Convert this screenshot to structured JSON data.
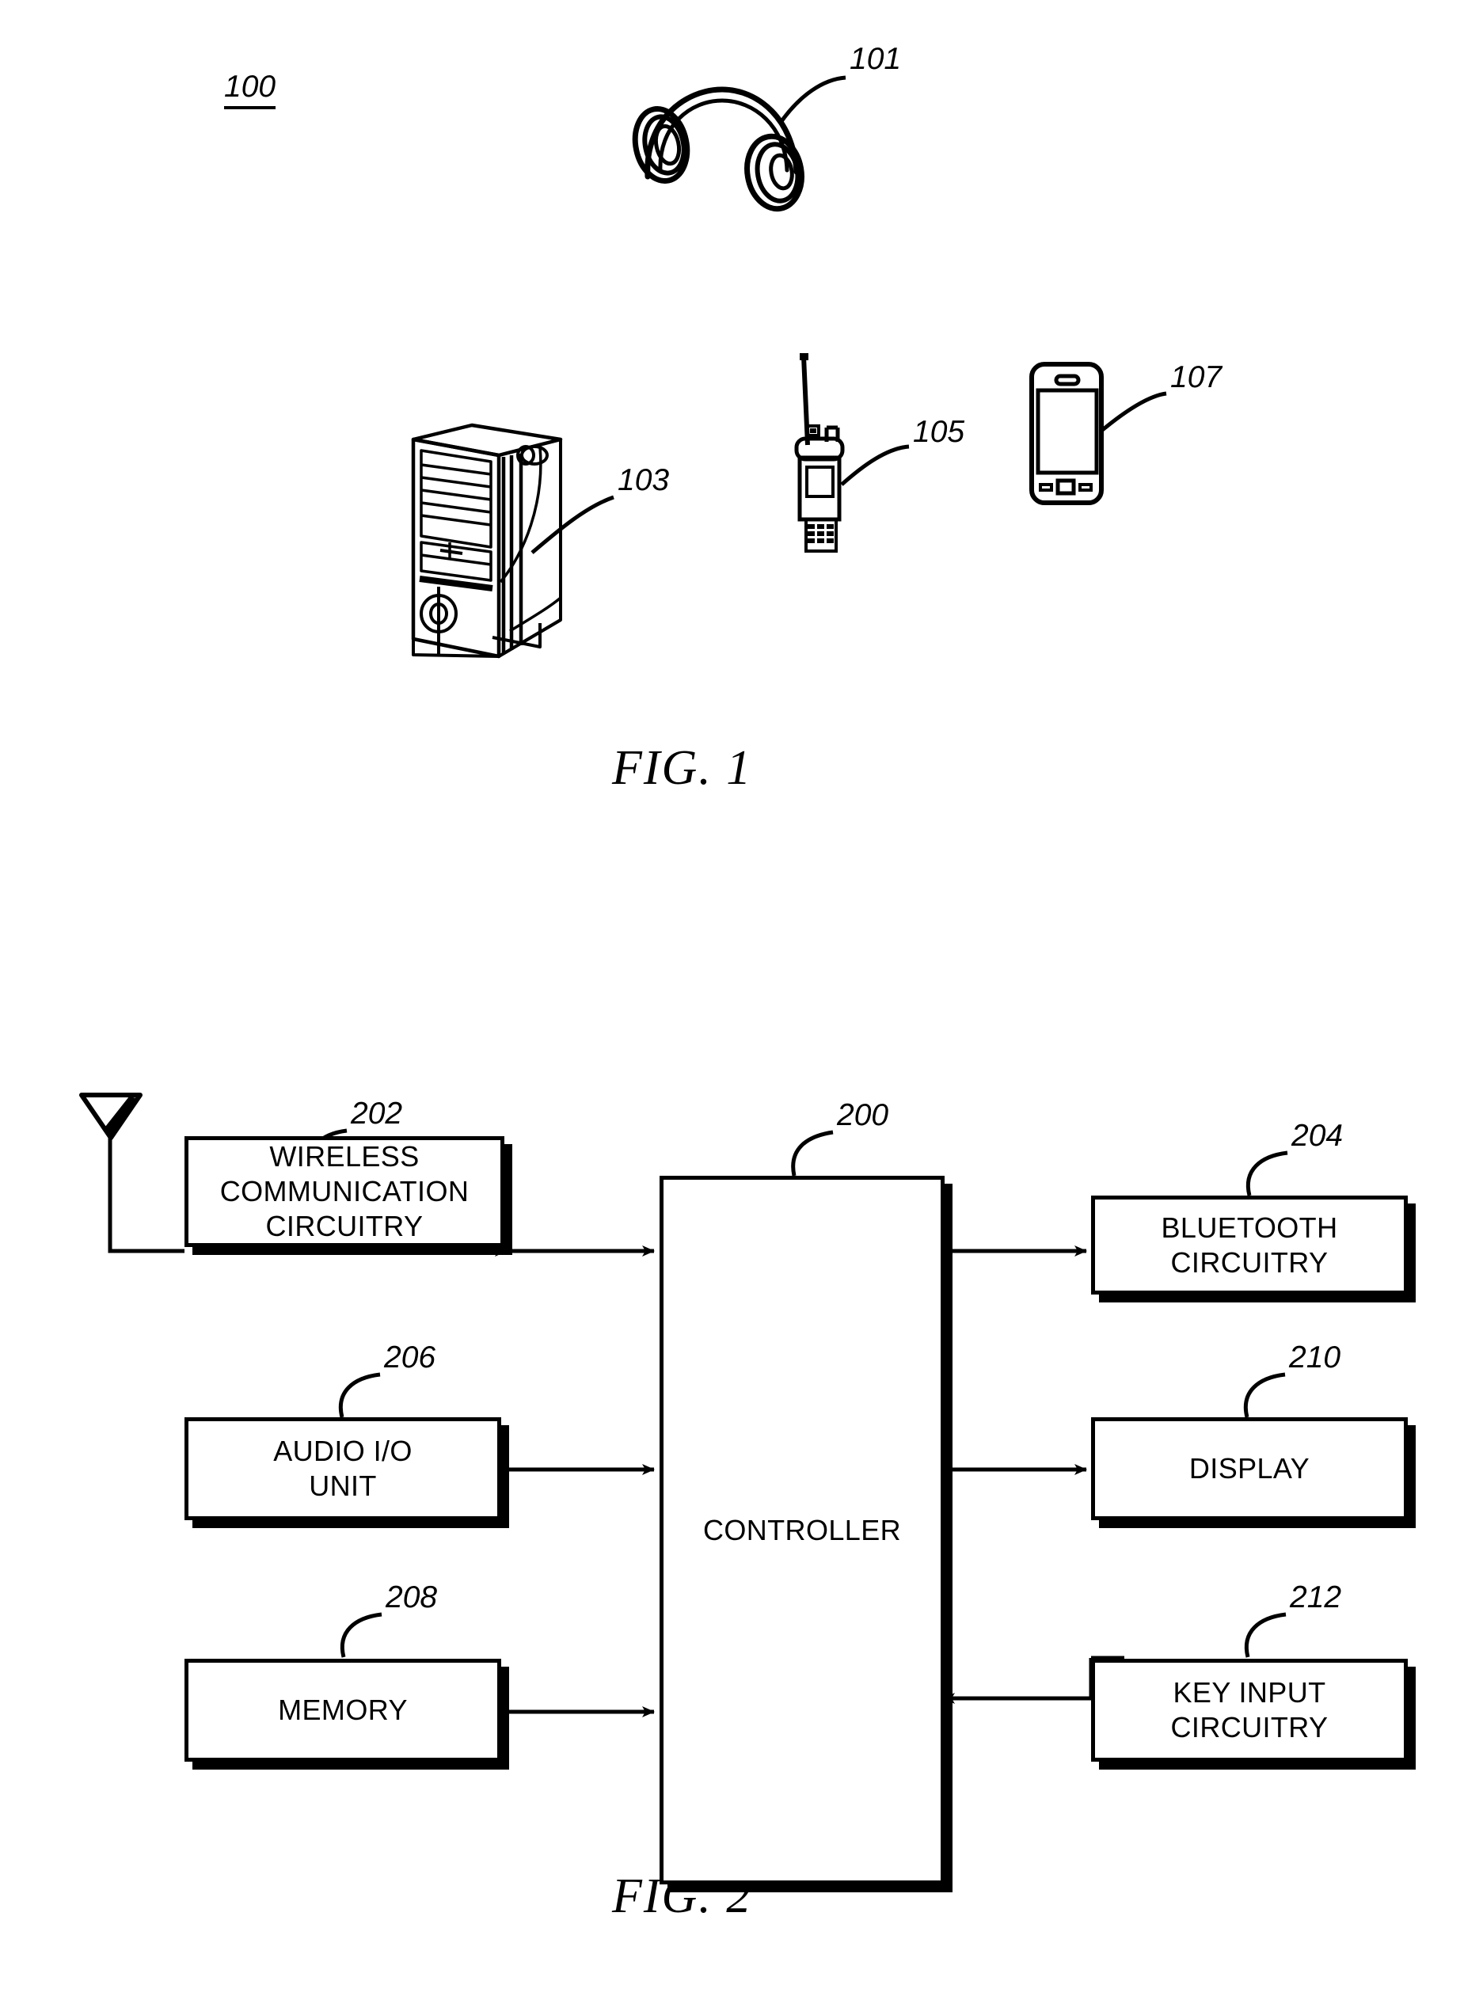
{
  "document": {
    "type": "patent-drawing-sheet",
    "figures": [
      {
        "caption": "FIG. 1",
        "system_label": "100",
        "items": [
          {
            "ref": "101",
            "name": "headphones"
          },
          {
            "ref": "103",
            "name": "desktop-computer-tower"
          },
          {
            "ref": "105",
            "name": "two-way-radio"
          },
          {
            "ref": "107",
            "name": "mobile-phone"
          }
        ]
      },
      {
        "caption": "FIG. 2",
        "items": [
          {
            "ref": "200",
            "name": "controller"
          },
          {
            "ref": "202",
            "name": "wireless-communication-circuitry"
          },
          {
            "ref": "204",
            "name": "bluetooth-circuitry"
          },
          {
            "ref": "206",
            "name": "audio-io-unit"
          },
          {
            "ref": "208",
            "name": "memory"
          },
          {
            "ref": "210",
            "name": "display"
          },
          {
            "ref": "212",
            "name": "key-input-circuitry"
          }
        ]
      }
    ]
  },
  "fig1": {
    "caption": "FIG. 1",
    "system_label": "100",
    "headphones_ref": "101",
    "computer_ref": "103",
    "radio_ref": "105",
    "phone_ref": "107"
  },
  "fig2": {
    "caption": "FIG. 2",
    "controller": {
      "ref": "200",
      "label": "CONTROLLER"
    },
    "wireless": {
      "ref": "202",
      "line1": "WIRELESS",
      "line2": "COMMUNICATION",
      "line3": "CIRCUITRY"
    },
    "bluetooth": {
      "ref": "204",
      "line1": "BLUETOOTH",
      "line2": "CIRCUITRY"
    },
    "audio": {
      "ref": "206",
      "line1": "AUDIO I/O",
      "line2": "UNIT"
    },
    "memory": {
      "ref": "208",
      "line1": "MEMORY"
    },
    "display": {
      "ref": "210",
      "line1": "DISPLAY"
    },
    "keyinput": {
      "ref": "212",
      "line1": "KEY INPUT",
      "line2": "CIRCUITRY"
    },
    "antenna": {
      "name": "antenna"
    },
    "connections": [
      {
        "from": "wireless",
        "to": "controller",
        "direction": "bidirectional"
      },
      {
        "from": "controller",
        "to": "bluetooth",
        "direction": "bidirectional"
      },
      {
        "from": "audio",
        "to": "controller",
        "direction": "bidirectional"
      },
      {
        "from": "controller",
        "to": "display",
        "direction": "to"
      },
      {
        "from": "memory",
        "to": "controller",
        "direction": "bidirectional"
      },
      {
        "from": "keyinput",
        "to": "controller",
        "direction": "to"
      },
      {
        "from": "antenna",
        "to": "wireless",
        "direction": "none"
      }
    ]
  },
  "colors": {
    "ink": "#000000",
    "paper": "#ffffff"
  }
}
